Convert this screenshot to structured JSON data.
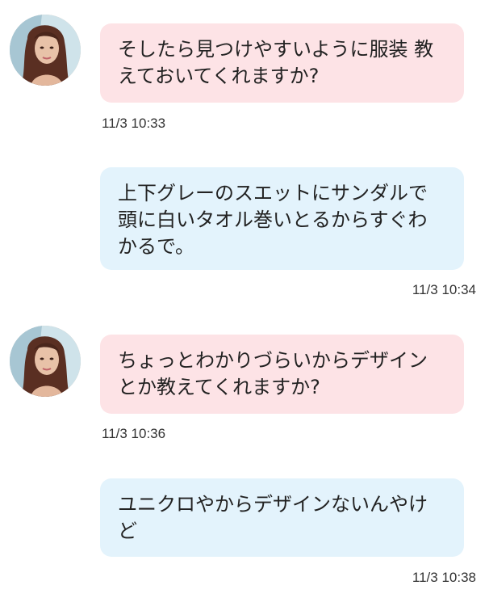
{
  "messages": [
    {
      "side": "in",
      "avatar": "woman-portrait-avatar",
      "text": "そしたら見つけやすいように服装 教えておいてくれますか?",
      "time": "11/3 10:33"
    },
    {
      "side": "out",
      "text": "上下グレーのスエットにサンダルで頭に白いタオル巻いとるからすぐわかるで。",
      "time": "11/3 10:34"
    },
    {
      "side": "in",
      "avatar": "woman-portrait-avatar",
      "text": "ちょっとわかりづらいからデザインとか教えてくれますか?",
      "time": "11/3 10:36"
    },
    {
      "side": "out",
      "text": "ユニクロやからデザインないんやけど",
      "time": "11/3 10:38"
    }
  ],
  "colors": {
    "incoming_bubble": "#fde3e6",
    "outgoing_bubble": "#e3f3fc",
    "text": "#222222",
    "timestamp": "#333333"
  }
}
